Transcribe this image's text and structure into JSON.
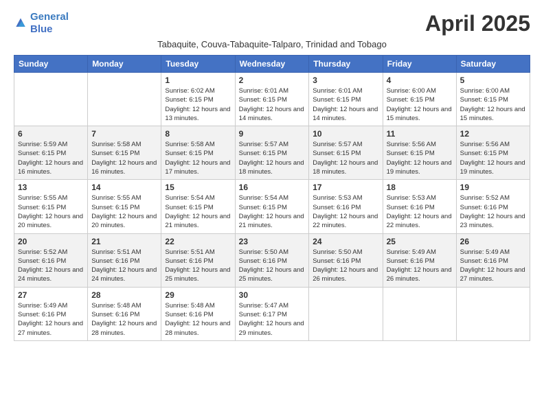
{
  "header": {
    "logo_line1": "General",
    "logo_line2": "Blue",
    "month_title": "April 2025",
    "subtitle": "Tabaquite, Couva-Tabaquite-Talparo, Trinidad and Tobago"
  },
  "days_of_week": [
    "Sunday",
    "Monday",
    "Tuesday",
    "Wednesday",
    "Thursday",
    "Friday",
    "Saturday"
  ],
  "weeks": [
    [
      {
        "day": "",
        "info": ""
      },
      {
        "day": "",
        "info": ""
      },
      {
        "day": "1",
        "info": "Sunrise: 6:02 AM\nSunset: 6:15 PM\nDaylight: 12 hours and 13 minutes."
      },
      {
        "day": "2",
        "info": "Sunrise: 6:01 AM\nSunset: 6:15 PM\nDaylight: 12 hours and 14 minutes."
      },
      {
        "day": "3",
        "info": "Sunrise: 6:01 AM\nSunset: 6:15 PM\nDaylight: 12 hours and 14 minutes."
      },
      {
        "day": "4",
        "info": "Sunrise: 6:00 AM\nSunset: 6:15 PM\nDaylight: 12 hours and 15 minutes."
      },
      {
        "day": "5",
        "info": "Sunrise: 6:00 AM\nSunset: 6:15 PM\nDaylight: 12 hours and 15 minutes."
      }
    ],
    [
      {
        "day": "6",
        "info": "Sunrise: 5:59 AM\nSunset: 6:15 PM\nDaylight: 12 hours and 16 minutes."
      },
      {
        "day": "7",
        "info": "Sunrise: 5:58 AM\nSunset: 6:15 PM\nDaylight: 12 hours and 16 minutes."
      },
      {
        "day": "8",
        "info": "Sunrise: 5:58 AM\nSunset: 6:15 PM\nDaylight: 12 hours and 17 minutes."
      },
      {
        "day": "9",
        "info": "Sunrise: 5:57 AM\nSunset: 6:15 PM\nDaylight: 12 hours and 18 minutes."
      },
      {
        "day": "10",
        "info": "Sunrise: 5:57 AM\nSunset: 6:15 PM\nDaylight: 12 hours and 18 minutes."
      },
      {
        "day": "11",
        "info": "Sunrise: 5:56 AM\nSunset: 6:15 PM\nDaylight: 12 hours and 19 minutes."
      },
      {
        "day": "12",
        "info": "Sunrise: 5:56 AM\nSunset: 6:15 PM\nDaylight: 12 hours and 19 minutes."
      }
    ],
    [
      {
        "day": "13",
        "info": "Sunrise: 5:55 AM\nSunset: 6:15 PM\nDaylight: 12 hours and 20 minutes."
      },
      {
        "day": "14",
        "info": "Sunrise: 5:55 AM\nSunset: 6:15 PM\nDaylight: 12 hours and 20 minutes."
      },
      {
        "day": "15",
        "info": "Sunrise: 5:54 AM\nSunset: 6:15 PM\nDaylight: 12 hours and 21 minutes."
      },
      {
        "day": "16",
        "info": "Sunrise: 5:54 AM\nSunset: 6:15 PM\nDaylight: 12 hours and 21 minutes."
      },
      {
        "day": "17",
        "info": "Sunrise: 5:53 AM\nSunset: 6:16 PM\nDaylight: 12 hours and 22 minutes."
      },
      {
        "day": "18",
        "info": "Sunrise: 5:53 AM\nSunset: 6:16 PM\nDaylight: 12 hours and 22 minutes."
      },
      {
        "day": "19",
        "info": "Sunrise: 5:52 AM\nSunset: 6:16 PM\nDaylight: 12 hours and 23 minutes."
      }
    ],
    [
      {
        "day": "20",
        "info": "Sunrise: 5:52 AM\nSunset: 6:16 PM\nDaylight: 12 hours and 24 minutes."
      },
      {
        "day": "21",
        "info": "Sunrise: 5:51 AM\nSunset: 6:16 PM\nDaylight: 12 hours and 24 minutes."
      },
      {
        "day": "22",
        "info": "Sunrise: 5:51 AM\nSunset: 6:16 PM\nDaylight: 12 hours and 25 minutes."
      },
      {
        "day": "23",
        "info": "Sunrise: 5:50 AM\nSunset: 6:16 PM\nDaylight: 12 hours and 25 minutes."
      },
      {
        "day": "24",
        "info": "Sunrise: 5:50 AM\nSunset: 6:16 PM\nDaylight: 12 hours and 26 minutes."
      },
      {
        "day": "25",
        "info": "Sunrise: 5:49 AM\nSunset: 6:16 PM\nDaylight: 12 hours and 26 minutes."
      },
      {
        "day": "26",
        "info": "Sunrise: 5:49 AM\nSunset: 6:16 PM\nDaylight: 12 hours and 27 minutes."
      }
    ],
    [
      {
        "day": "27",
        "info": "Sunrise: 5:49 AM\nSunset: 6:16 PM\nDaylight: 12 hours and 27 minutes."
      },
      {
        "day": "28",
        "info": "Sunrise: 5:48 AM\nSunset: 6:16 PM\nDaylight: 12 hours and 28 minutes."
      },
      {
        "day": "29",
        "info": "Sunrise: 5:48 AM\nSunset: 6:16 PM\nDaylight: 12 hours and 28 minutes."
      },
      {
        "day": "30",
        "info": "Sunrise: 5:47 AM\nSunset: 6:17 PM\nDaylight: 12 hours and 29 minutes."
      },
      {
        "day": "",
        "info": ""
      },
      {
        "day": "",
        "info": ""
      },
      {
        "day": "",
        "info": ""
      }
    ]
  ]
}
